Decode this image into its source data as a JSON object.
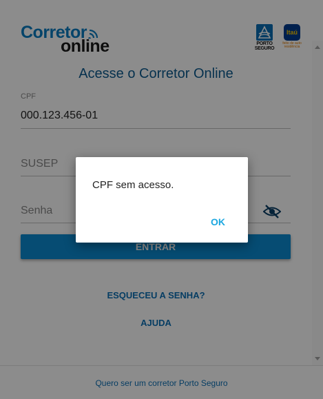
{
  "header": {
    "logo_corretor_line1": "Corretor",
    "logo_corretor_line2": "online",
    "logo_porto_text_line1": "PORTO",
    "logo_porto_text_line2": "SEGURO",
    "logo_itau_text": "Itaú",
    "logo_itau_sub1": "feito de auto",
    "logo_itau_sub2": "residência"
  },
  "form": {
    "title": "Acesse o Corretor Online",
    "cpf_label": "CPF",
    "cpf_value": "000.123.456-01",
    "susep_placeholder": "SUSEP",
    "senha_placeholder": "Senha",
    "submit_label": "ENTRAR"
  },
  "links": {
    "forgot_password": "ESQUECEU A SENHA?",
    "help": "AJUDA"
  },
  "footer": {
    "text": "Quero ser um corretor Porto Seguro"
  },
  "dialog": {
    "message": "CPF sem acesso.",
    "ok_label": "OK"
  },
  "colors": {
    "brand_blue": "#0c8bd1",
    "dialog_accent": "#1ba7e0",
    "title_blue": "#0b5a8e"
  }
}
